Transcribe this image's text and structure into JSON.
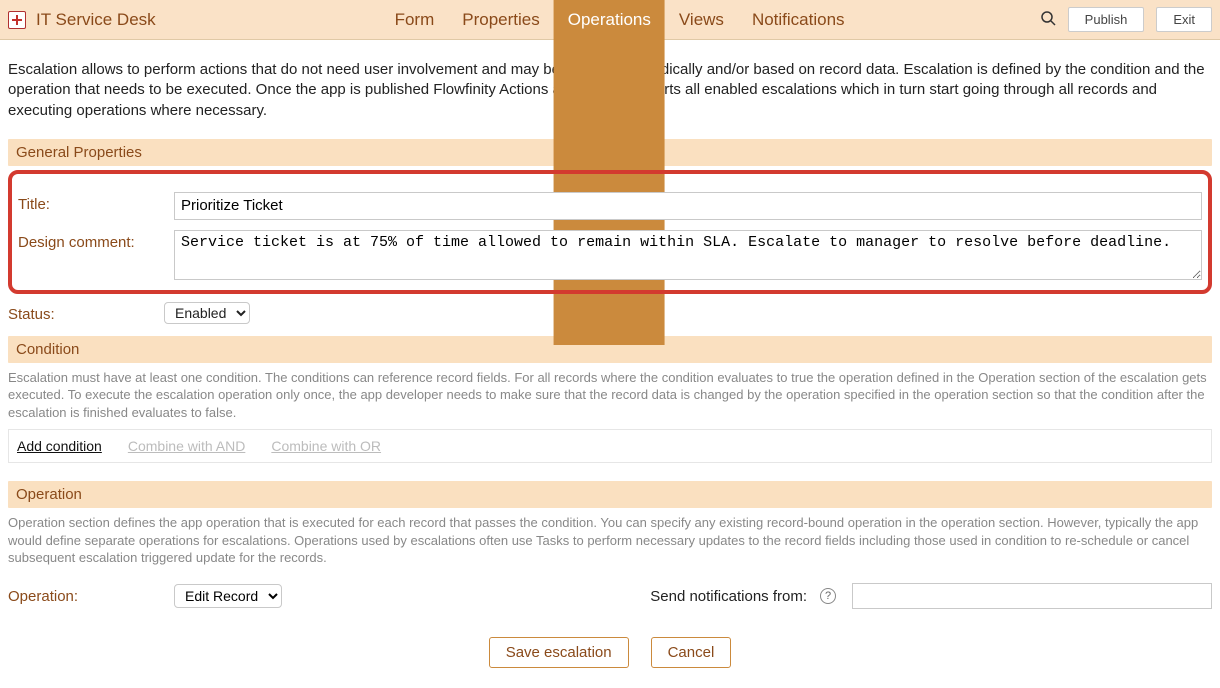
{
  "header": {
    "app_title": "IT Service Desk",
    "tabs": [
      "Form",
      "Properties",
      "Operations",
      "Views",
      "Notifications"
    ],
    "active_tab": 2,
    "publish_label": "Publish",
    "exit_label": "Exit"
  },
  "intro_text": "Escalation allows to perform actions that do not need user involvement and may be triggered periodically and/or based on record data. Escalation is defined by the condition and the operation that needs to be executed. Once the app is published Flowfinity Actions automatically starts all enabled escalations which in turn start going through all records and executing operations where necessary.",
  "general": {
    "section_title": "General Properties",
    "title_label": "Title:",
    "title_value": "Prioritize Ticket",
    "design_comment_label": "Design comment:",
    "design_comment_value": "Service ticket is at 75% of time allowed to remain within SLA. Escalate to manager to resolve before deadline.",
    "status_label": "Status:",
    "status_value": "Enabled"
  },
  "condition": {
    "section_title": "Condition",
    "help_text": "Escalation must have at least one condition. The conditions can reference record fields. For all records where the condition evaluates to true the operation defined in the Operation section of the escalation gets executed. To execute the escalation operation only once, the app developer needs to make sure that the record data is changed by the operation specified in the operation section so that the condition after the escalation is finished evaluates to false.",
    "links": {
      "add": "Add condition",
      "combine_and": "Combine with AND",
      "combine_or": "Combine with OR"
    }
  },
  "operation": {
    "section_title": "Operation",
    "help_text": "Operation section defines the app operation that is executed for each record that passes the condition. You can specify any existing record-bound operation in the operation section. However, typically the app would define separate operations for escalations. Operations used by escalations often use Tasks to perform necessary updates to the record fields including those used in condition to re-schedule or cancel subsequent escalation triggered update for the records.",
    "operation_label": "Operation:",
    "operation_value": "Edit Record",
    "notif_label": "Send notifications from:",
    "notif_value": ""
  },
  "buttons": {
    "save": "Save escalation",
    "cancel": "Cancel"
  }
}
